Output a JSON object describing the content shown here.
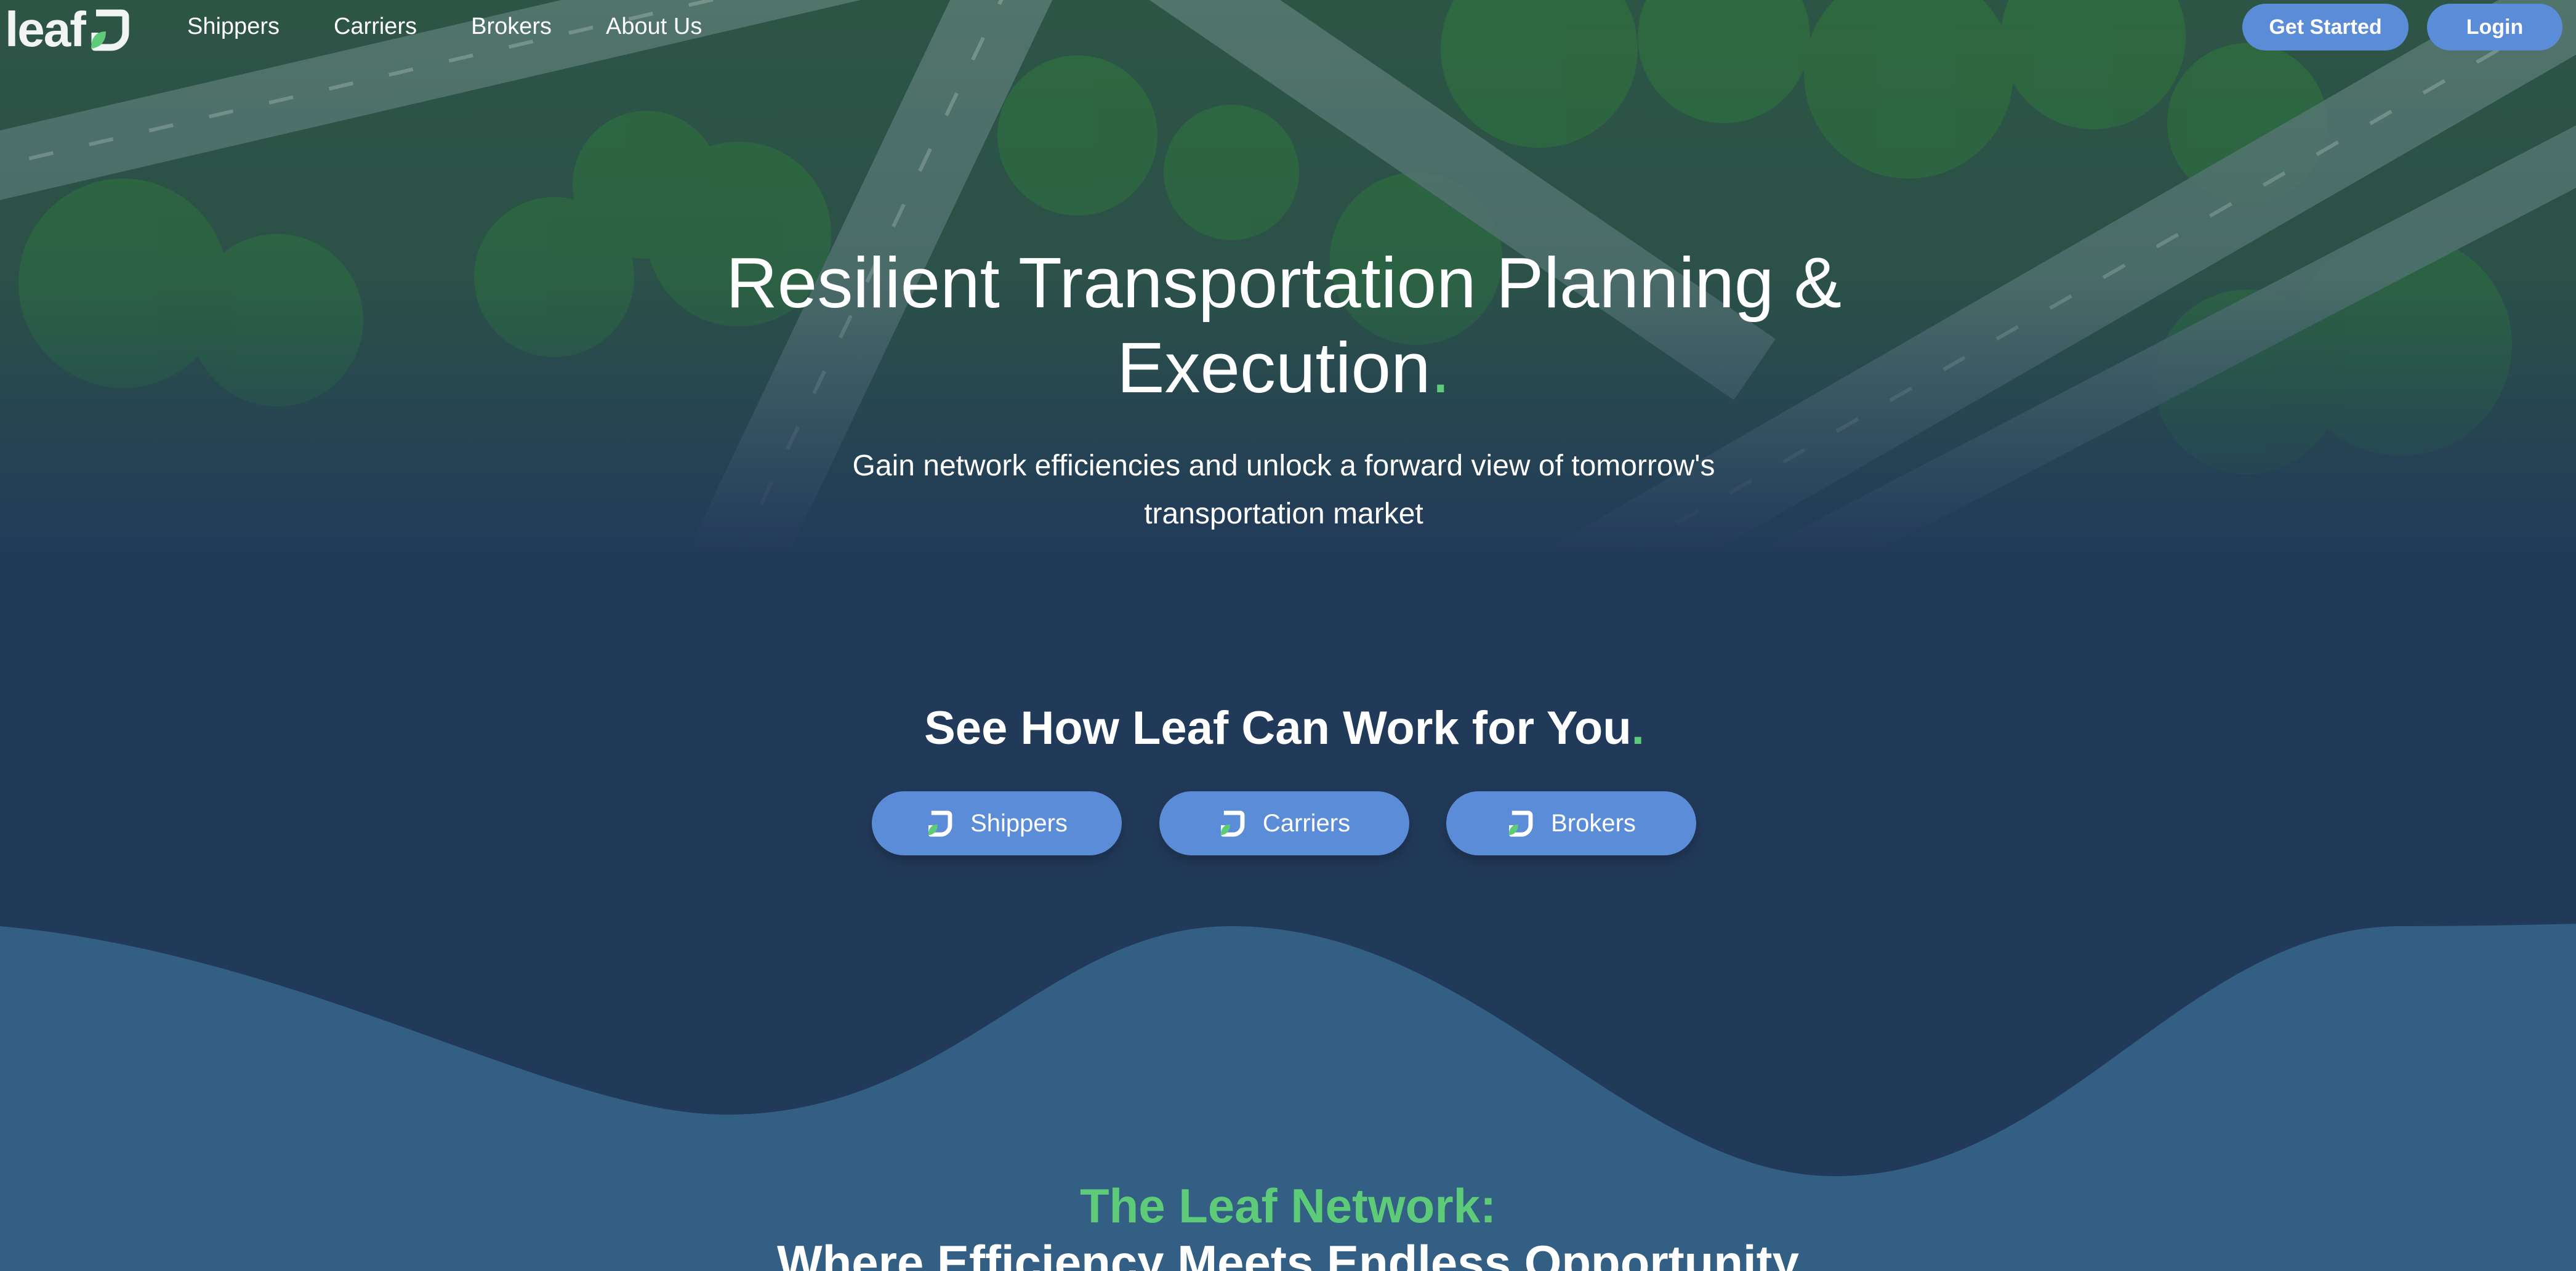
{
  "brand": {
    "logo_text": "leaf",
    "accent": "#5dcb78",
    "button_color": "#5b8cd8",
    "bg_color": "#223a5a",
    "wave_color": "#335f84"
  },
  "nav": {
    "links": [
      "Shippers",
      "Carriers",
      "Brokers",
      "About Us"
    ],
    "get_started": "Get Started",
    "login": "Login"
  },
  "hero": {
    "title": "Resilient Transportation Planning & Execution",
    "title_dot": ".",
    "subtitle_line1": "Gain network efficiencies and unlock a forward view of tomorrow's",
    "subtitle_line2": "transportation market"
  },
  "see_how": {
    "title": "See How Leaf Can Work for You",
    "title_dot": ".",
    "buttons": [
      {
        "label": "Shippers",
        "icon": "leaf-logo-icon"
      },
      {
        "label": "Carriers",
        "icon": "leaf-logo-icon"
      },
      {
        "label": "Brokers",
        "icon": "leaf-logo-icon"
      }
    ]
  },
  "network": {
    "title": "The Leaf Network:",
    "subtitle": "Where Efficiency Meets Endless Opportunity"
  }
}
